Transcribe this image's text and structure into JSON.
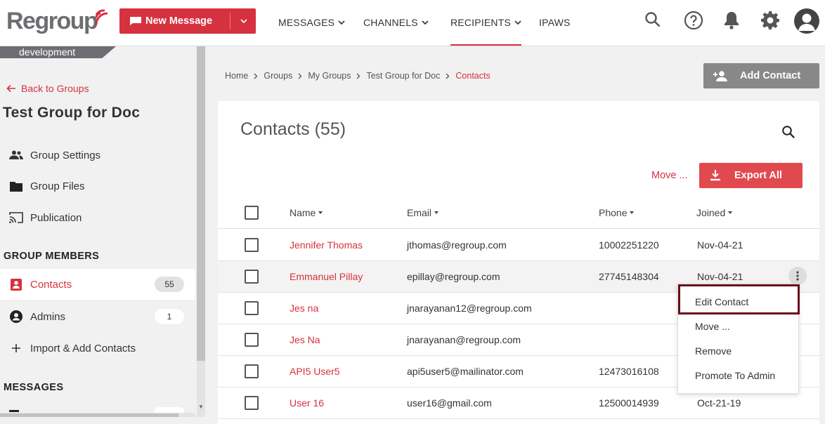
{
  "brand": {
    "logo_text": "Regroup",
    "accent": "#d6313f"
  },
  "toolbar": {
    "new_message_label": "New Message",
    "nav": [
      {
        "label": "MESSAGES",
        "has_menu": true
      },
      {
        "label": "CHANNELS",
        "has_menu": true
      },
      {
        "label": "RECIPIENTS",
        "has_menu": true,
        "active": true
      },
      {
        "label": "IPAWS",
        "has_menu": false
      }
    ],
    "icons": [
      "search-icon",
      "help-icon",
      "bell-icon",
      "gear-icon",
      "user-avatar-icon"
    ]
  },
  "sidebar": {
    "environment": "development",
    "back_label": "Back to Groups",
    "group_title": "Test Group for Doc",
    "group_items": [
      {
        "label": "Group Settings",
        "icon": "people-icon"
      },
      {
        "label": "Group Files",
        "icon": "folder-icon"
      },
      {
        "label": "Publication",
        "icon": "cast-icon"
      }
    ],
    "members_heading": "GROUP MEMBERS",
    "member_items": [
      {
        "label": "Contacts",
        "count": "55",
        "icon": "contact-card-icon",
        "active": true
      },
      {
        "label": "Admins",
        "count": "1",
        "icon": "account-circle-icon"
      },
      {
        "label": "Import & Add Contacts",
        "icon": "plus-icon"
      }
    ],
    "messages_heading": "MESSAGES"
  },
  "breadcrumb": [
    "Home",
    "Groups",
    "My Groups",
    "Test Group for Doc",
    "Contacts"
  ],
  "main": {
    "add_contact_label": "Add Contact",
    "title": "Contacts (55)",
    "move_label": "Move ...",
    "export_label": "Export All",
    "columns": [
      "Name",
      "Email",
      "Phone",
      "Joined"
    ],
    "rows": [
      {
        "name": "Jennifer Thomas",
        "email": "jthomas@regroup.com",
        "phone": "10002251220",
        "joined": "Nov-04-21"
      },
      {
        "name": "Emmanuel Pillay",
        "email": "epillay@regroup.com",
        "phone": "27745148304",
        "joined": "Nov-04-21"
      },
      {
        "name": "Jes na",
        "email": "jnarayanan12@regroup.com",
        "phone": "",
        "joined": ""
      },
      {
        "name": "Jes Na",
        "email": "jnarayanan@regroup.com",
        "phone": "",
        "joined": ""
      },
      {
        "name": "API5 User5",
        "email": "api5user5@mailinator.com",
        "phone": "12473016108",
        "joined": ""
      },
      {
        "name": "User 16",
        "email": "user16@gmail.com",
        "phone": "12500014939",
        "joined": "Oct-21-19"
      }
    ]
  },
  "row_menu": {
    "items": [
      "Edit Contact",
      "Move ...",
      "Remove",
      "Promote To Admin"
    ]
  }
}
